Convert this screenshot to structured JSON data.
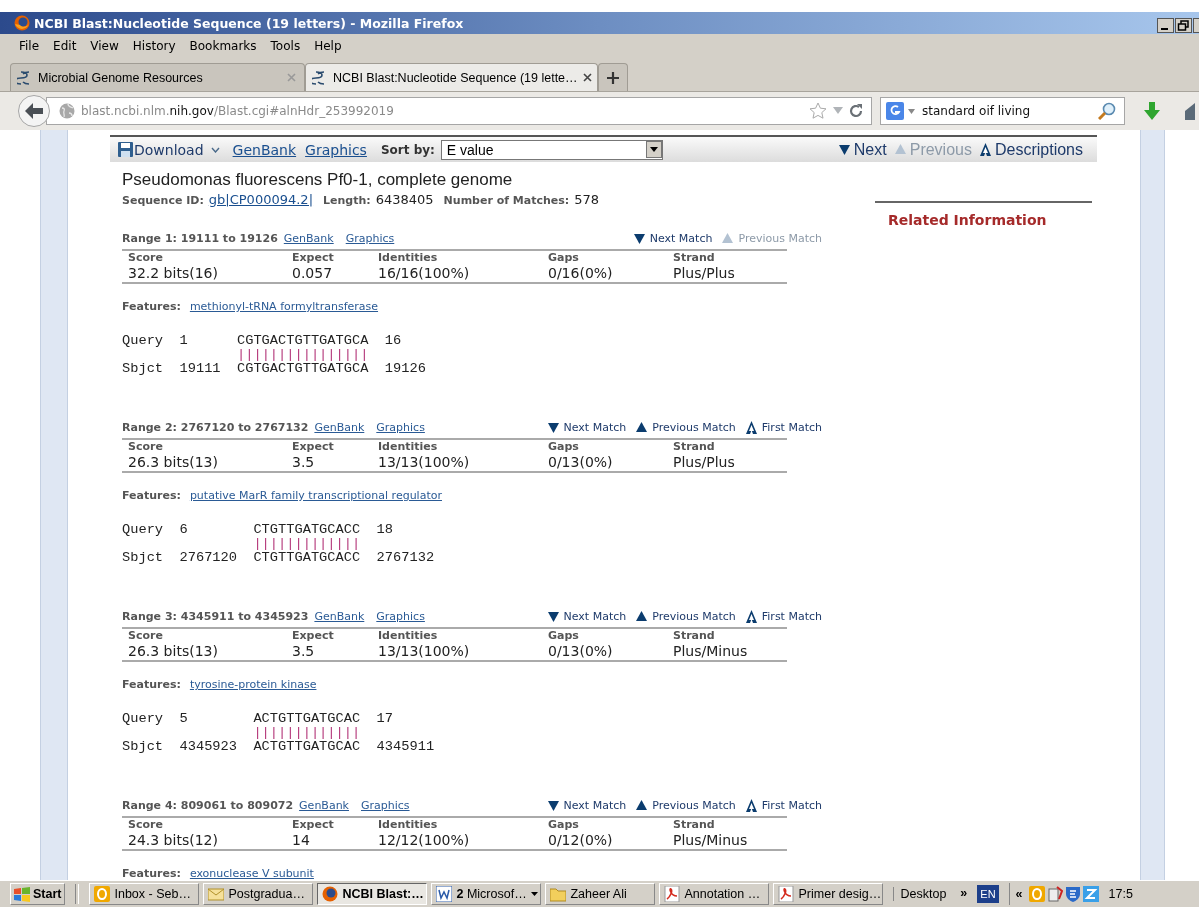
{
  "window": {
    "title": "NCBI Blast:Nucleotide Sequence (19 letters) - Mozilla Firefox"
  },
  "menu": [
    "File",
    "Edit",
    "View",
    "History",
    "Bookmarks",
    "Tools",
    "Help"
  ],
  "tabs": [
    {
      "label": "Microbial Genome Resources",
      "selected": false
    },
    {
      "label": "NCBI Blast:Nucleotide Sequence (19 lette…",
      "selected": true
    }
  ],
  "address_bar": {
    "url_start": "blast.ncbi.nlm.",
    "url_host": "nih.gov",
    "url_rest": "/Blast.cgi#alnHdr_253992019"
  },
  "search": {
    "value": "standard oif living"
  },
  "results_toolbar": {
    "download": "Download",
    "links": [
      "GenBank",
      "Graphics"
    ],
    "sort_label": "Sort by:",
    "sort_value": "E value",
    "nav": [
      {
        "label": "Next",
        "kind": "next",
        "disabled": false
      },
      {
        "label": "Previous",
        "kind": "previous",
        "disabled": true
      },
      {
        "label": "Descriptions",
        "kind": "first",
        "disabled": false
      }
    ]
  },
  "hit": {
    "title": "Pseudomonas fluorescens Pf0-1, complete genome",
    "seq_id_label": "Sequence ID:",
    "seq_id": "gb|CP000094.2|",
    "length_label": "Length:",
    "length": "6438405",
    "matches_label": "Number of Matches:",
    "matches": "578"
  },
  "ranges": [
    {
      "title": "Range 1: 19111 to 19126",
      "links": [
        "GenBank",
        "Graphics"
      ],
      "nav": [
        {
          "label": "Next Match",
          "kind": "next",
          "disabled": false
        },
        {
          "label": "Previous Match",
          "kind": "previous",
          "disabled": true
        }
      ],
      "columns": [
        "Score",
        "Expect",
        "Identities",
        "Gaps",
        "Strand"
      ],
      "values": [
        "32.2 bits(16)",
        "0.057",
        "16/16(100%)",
        "0/16(0%)",
        "Plus/Plus"
      ],
      "features_label": "Features:",
      "feature": "methionyl-tRNA formyltransferase",
      "alignment": {
        "query": {
          "label": "Query",
          "start": "1",
          "seq": "CGTGACTGTTGATGCA",
          "end": "16"
        },
        "midline": "||||||||||||||||",
        "sbjct": {
          "label": "Sbjct",
          "start": "19111",
          "seq": "CGTGACTGTTGATGCA",
          "end": "19126"
        }
      }
    },
    {
      "title": "Range 2: 2767120 to 2767132",
      "links": [
        "GenBank",
        "Graphics"
      ],
      "nav": [
        {
          "label": "Next Match",
          "kind": "next",
          "disabled": false
        },
        {
          "label": "Previous Match",
          "kind": "previous",
          "disabled": false
        },
        {
          "label": "First Match",
          "kind": "first",
          "disabled": false
        }
      ],
      "columns": [
        "Score",
        "Expect",
        "Identities",
        "Gaps",
        "Strand"
      ],
      "values": [
        "26.3 bits(13)",
        "3.5",
        "13/13(100%)",
        "0/13(0%)",
        "Plus/Plus"
      ],
      "features_label": "Features:",
      "feature": "putative MarR family transcriptional regulator",
      "alignment": {
        "query": {
          "label": "Query",
          "start": "6",
          "seq": "CTGTTGATGCACC",
          "end": "18"
        },
        "midline": "|||||||||||||",
        "sbjct": {
          "label": "Sbjct",
          "start": "2767120",
          "seq": "CTGTTGATGCACC",
          "end": "2767132"
        }
      }
    },
    {
      "title": "Range 3: 4345911 to 4345923",
      "links": [
        "GenBank",
        "Graphics"
      ],
      "nav": [
        {
          "label": "Next Match",
          "kind": "next",
          "disabled": false
        },
        {
          "label": "Previous Match",
          "kind": "previous",
          "disabled": false
        },
        {
          "label": "First Match",
          "kind": "first",
          "disabled": false
        }
      ],
      "columns": [
        "Score",
        "Expect",
        "Identities",
        "Gaps",
        "Strand"
      ],
      "values": [
        "26.3 bits(13)",
        "3.5",
        "13/13(100%)",
        "0/13(0%)",
        "Plus/Minus"
      ],
      "features_label": "Features:",
      "feature": "tyrosine-protein kinase",
      "alignment": {
        "query": {
          "label": "Query",
          "start": "5",
          "seq": "ACTGTTGATGCAC",
          "end": "17"
        },
        "midline": "|||||||||||||",
        "sbjct": {
          "label": "Sbjct",
          "start": "4345923",
          "seq": "ACTGTTGATGCAC",
          "end": "4345911"
        }
      }
    },
    {
      "title": "Range 4: 809061 to 809072",
      "links": [
        "GenBank",
        "Graphics"
      ],
      "nav": [
        {
          "label": "Next Match",
          "kind": "next",
          "disabled": false
        },
        {
          "label": "Previous Match",
          "kind": "previous",
          "disabled": false
        },
        {
          "label": "First Match",
          "kind": "first",
          "disabled": false
        }
      ],
      "columns": [
        "Score",
        "Expect",
        "Identities",
        "Gaps",
        "Strand"
      ],
      "values": [
        "24.3 bits(12)",
        "14",
        "12/12(100%)",
        "0/12(0%)",
        "Plus/Minus"
      ],
      "features_label": "Features:",
      "feature": "exonuclease V subunit"
    }
  ],
  "related": {
    "title": "Related Information"
  },
  "taskbar": {
    "start": "Start",
    "items": [
      {
        "label": "Inbox - Seb…",
        "kind": "outlook",
        "selected": false
      },
      {
        "label": "Postgradua…",
        "kind": "mail",
        "selected": false
      },
      {
        "label": "NCBI Blast:…",
        "kind": "firefox",
        "selected": true
      },
      {
        "label": "**2** Microsof…",
        "kind": "word",
        "selected": false
      },
      {
        "label": "Zaheer Ali",
        "kind": "folder",
        "selected": false
      },
      {
        "label": "Annotation …",
        "kind": "pdf",
        "selected": false
      },
      {
        "label": "Primer desig…",
        "kind": "pdf",
        "selected": false
      }
    ],
    "desktop": "Desktop",
    "desktop_chevron": "»",
    "language": "EN",
    "tray_chevron": "«",
    "clock": "17:5"
  }
}
